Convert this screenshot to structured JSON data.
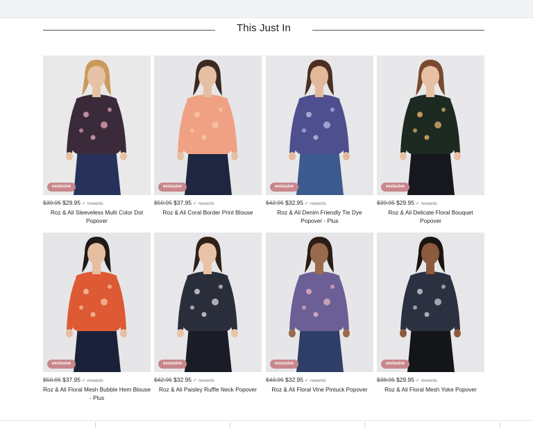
{
  "section": {
    "title": "This Just In"
  },
  "products": [
    {
      "badge": "exclusive",
      "old_price": "$39.95",
      "price": "$29.95",
      "rewards": "rewards",
      "name": "Roz & Ali Sleeveless Multi Color Dot Popover",
      "bg": "#e9e9ea",
      "skin": "#e8c2a6",
      "hair": "#c99a5b",
      "top": "#3b2b3a",
      "top_accent": "#e1a9b4",
      "pants": "#27315a"
    },
    {
      "badge": "exclusive",
      "old_price": "$50.95",
      "price": "$37.95",
      "rewards": "rewards",
      "name": "Roz & Ali Coral Border Print Blouse",
      "bg": "#e6e6e8",
      "skin": "#e6bfa2",
      "hair": "#3a2a22",
      "top": "#f0a184",
      "top_accent": "#f6c7a9",
      "pants": "#1f2640"
    },
    {
      "badge": "exclusive",
      "old_price": "$42.95",
      "price": "$32.95",
      "rewards": "rewards",
      "name": "Roz & Ali Denim Friendly Tie Dye Popover - Plus",
      "bg": "#e7e7e9",
      "skin": "#e3b99b",
      "hair": "#4a2f22",
      "top": "#4d4f8e",
      "top_accent": "#b9bde3",
      "pants": "#3d5a8e"
    },
    {
      "badge": "exclusive",
      "old_price": "$39.95",
      "price": "$29.95",
      "rewards": "rewards",
      "name": "Roz & Ali Delicate Floral Bouquet Popover",
      "bg": "#e8e8ea",
      "skin": "#e8c0a3",
      "hair": "#7a4a30",
      "top": "#1d2a22",
      "top_accent": "#e6b36b",
      "pants": "#16181d"
    },
    {
      "badge": "exclusive",
      "old_price": "$50.95",
      "price": "$37.95",
      "rewards": "rewards",
      "name": "Roz & Ali Floral Mesh Bubble Hem Blouse - Plus",
      "bg": "#e6e6e8",
      "skin": "#e6bea0",
      "hair": "#1f1a18",
      "top": "#de5a34",
      "top_accent": "#f5c5a0",
      "pants": "#1b2138"
    },
    {
      "badge": "exclusive",
      "old_price": "$42.95",
      "price": "$32.95",
      "rewards": "rewards",
      "name": "Roz & Ali Paisley Ruffle Neck Popover",
      "bg": "#e7e7e9",
      "skin": "#e9c3a7",
      "hair": "#2e2119",
      "top": "#2a2d3a",
      "top_accent": "#d6d7e0",
      "pants": "#1a1c26"
    },
    {
      "badge": "exclusive",
      "old_price": "$43.95",
      "price": "$32.95",
      "rewards": "rewards",
      "name": "Roz & Ali Floral Vine Pintuck Popover",
      "bg": "#e6e6e8",
      "skin": "#9a6a4d",
      "hair": "#2a1d15",
      "top": "#6c5f95",
      "top_accent": "#e7b3c3",
      "pants": "#2e3e67"
    },
    {
      "badge": "exclusive",
      "old_price": "$38.95",
      "price": "$29.95",
      "rewards": "rewards",
      "name": "Roz & Ali Floral Mesh Yoke Popover",
      "bg": "#e7e7e9",
      "skin": "#8c5a3d",
      "hair": "#1a1412",
      "top": "#2b3140",
      "top_accent": "#c9ccd8",
      "pants": "#141518"
    }
  ]
}
